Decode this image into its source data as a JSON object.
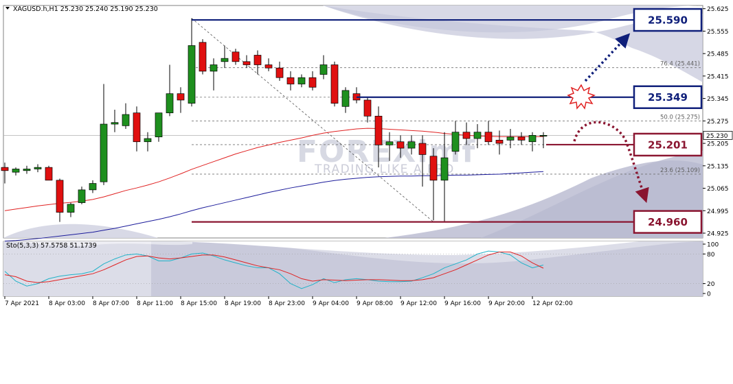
{
  "header": {
    "symbol_line": "XAGUSD.h,H1  25.230 25.240 25.190 25.230"
  },
  "watermark": {
    "brand": "FOREXimf",
    "tagline": "TRADING LIKE A PRO"
  },
  "colors": {
    "bull": "#1e8f1e",
    "bear": "#e01010",
    "navy": "#0f1f7a",
    "maroon": "#8a1530",
    "ma_fast": "#e02020",
    "ma_slow": "#1a1a9a",
    "stoch_main": "#20b2c8",
    "stoch_signal": "#e02020",
    "grid": "#c8c8c8",
    "swoosh": "#aeb0c8"
  },
  "chart_data": [
    {
      "type": "candlestick",
      "symbol": "XAGUSD.h",
      "timeframe": "H1",
      "ylim": [
        24.91,
        25.635
      ],
      "y_ticks": [
        "25.625",
        "25.555",
        "25.485",
        "25.415",
        "25.345",
        "25.275",
        "25.205",
        "25.135",
        "25.065",
        "24.995",
        "24.925"
      ],
      "current_price_label": "25.230",
      "x_labels": [
        "7 Apr 2021",
        "8 Apr 03:00",
        "8 Apr 07:00",
        "8 Apr 11:00",
        "8 Apr 15:00",
        "8 Apr 19:00",
        "8 Apr 23:00",
        "9 Apr 04:00",
        "9 Apr 08:00",
        "9 Apr 12:00",
        "9 Apr 16:00",
        "9 Apr 20:00",
        "12 Apr 02:00"
      ],
      "x_label_bars": [
        0,
        4,
        8,
        12,
        16,
        20,
        24,
        28,
        32,
        36,
        40,
        44,
        48
      ],
      "candles": [
        {
          "o": 25.13,
          "h": 25.145,
          "l": 25.08,
          "c": 25.12
        },
        {
          "o": 25.115,
          "h": 25.13,
          "l": 25.105,
          "c": 25.125
        },
        {
          "o": 25.12,
          "h": 25.135,
          "l": 25.11,
          "c": 25.125
        },
        {
          "o": 25.125,
          "h": 25.14,
          "l": 25.115,
          "c": 25.13
        },
        {
          "o": 25.13,
          "h": 25.135,
          "l": 25.1,
          "c": 25.09
        },
        {
          "o": 25.09,
          "h": 25.095,
          "l": 24.96,
          "c": 24.99
        },
        {
          "o": 24.99,
          "h": 25.02,
          "l": 24.975,
          "c": 25.015
        },
        {
          "o": 25.02,
          "h": 25.07,
          "l": 25.015,
          "c": 25.06
        },
        {
          "o": 25.06,
          "h": 25.09,
          "l": 25.05,
          "c": 25.08
        },
        {
          "o": 25.085,
          "h": 25.39,
          "l": 25.075,
          "c": 25.265
        },
        {
          "o": 25.265,
          "h": 25.31,
          "l": 25.24,
          "c": 25.27
        },
        {
          "o": 25.26,
          "h": 25.33,
          "l": 25.25,
          "c": 25.295
        },
        {
          "o": 25.3,
          "h": 25.32,
          "l": 25.18,
          "c": 25.21
        },
        {
          "o": 25.21,
          "h": 25.24,
          "l": 25.18,
          "c": 25.22
        },
        {
          "o": 25.225,
          "h": 25.3,
          "l": 25.21,
          "c": 25.3
        },
        {
          "o": 25.3,
          "h": 25.45,
          "l": 25.29,
          "c": 25.36
        },
        {
          "o": 25.36,
          "h": 25.38,
          "l": 25.3,
          "c": 25.34
        },
        {
          "o": 25.33,
          "h": 25.595,
          "l": 25.32,
          "c": 25.51
        },
        {
          "o": 25.52,
          "h": 25.53,
          "l": 25.42,
          "c": 25.43
        },
        {
          "o": 25.43,
          "h": 25.47,
          "l": 25.37,
          "c": 25.45
        },
        {
          "o": 25.46,
          "h": 25.51,
          "l": 25.44,
          "c": 25.47
        },
        {
          "o": 25.49,
          "h": 25.5,
          "l": 25.45,
          "c": 25.46
        },
        {
          "o": 25.46,
          "h": 25.48,
          "l": 25.44,
          "c": 25.45
        },
        {
          "o": 25.48,
          "h": 25.495,
          "l": 25.42,
          "c": 25.45
        },
        {
          "o": 25.45,
          "h": 25.47,
          "l": 25.43,
          "c": 25.44
        },
        {
          "o": 25.44,
          "h": 25.46,
          "l": 25.4,
          "c": 25.41
        },
        {
          "o": 25.41,
          "h": 25.43,
          "l": 25.37,
          "c": 25.39
        },
        {
          "o": 25.39,
          "h": 25.42,
          "l": 25.38,
          "c": 25.41
        },
        {
          "o": 25.41,
          "h": 25.43,
          "l": 25.37,
          "c": 25.38
        },
        {
          "o": 25.42,
          "h": 25.48,
          "l": 25.405,
          "c": 25.45
        },
        {
          "o": 25.45,
          "h": 25.46,
          "l": 25.32,
          "c": 25.33
        },
        {
          "o": 25.32,
          "h": 25.38,
          "l": 25.3,
          "c": 25.37
        },
        {
          "o": 25.36,
          "h": 25.38,
          "l": 25.33,
          "c": 25.34
        },
        {
          "o": 25.34,
          "h": 25.35,
          "l": 25.27,
          "c": 25.29
        },
        {
          "o": 25.29,
          "h": 25.32,
          "l": 25.13,
          "c": 25.2
        },
        {
          "o": 25.2,
          "h": 25.24,
          "l": 25.15,
          "c": 25.21
        },
        {
          "o": 25.21,
          "h": 25.23,
          "l": 25.16,
          "c": 25.19
        },
        {
          "o": 25.19,
          "h": 25.23,
          "l": 25.17,
          "c": 25.21
        },
        {
          "o": 25.205,
          "h": 25.23,
          "l": 25.07,
          "c": 25.17
        },
        {
          "o": 25.165,
          "h": 25.19,
          "l": 24.965,
          "c": 25.09
        },
        {
          "o": 25.09,
          "h": 25.24,
          "l": 24.96,
          "c": 25.16
        },
        {
          "o": 25.18,
          "h": 25.275,
          "l": 25.17,
          "c": 25.24
        },
        {
          "o": 25.24,
          "h": 25.27,
          "l": 25.2,
          "c": 25.22
        },
        {
          "o": 25.22,
          "h": 25.265,
          "l": 25.19,
          "c": 25.24
        },
        {
          "o": 25.24,
          "h": 25.275,
          "l": 25.2,
          "c": 25.21
        },
        {
          "o": 25.215,
          "h": 25.245,
          "l": 25.17,
          "c": 25.205
        },
        {
          "o": 25.215,
          "h": 25.25,
          "l": 25.19,
          "c": 25.225
        },
        {
          "o": 25.225,
          "h": 25.24,
          "l": 25.2,
          "c": 25.215
        },
        {
          "o": 25.21,
          "h": 25.24,
          "l": 25.18,
          "c": 25.23
        },
        {
          "o": 25.23,
          "h": 25.24,
          "l": 25.19,
          "c": 25.23
        }
      ],
      "ma_fast": [
        24.995,
        25.0,
        25.005,
        25.01,
        25.014,
        25.018,
        25.021,
        25.025,
        25.03,
        25.038,
        25.048,
        25.058,
        25.066,
        25.075,
        25.085,
        25.097,
        25.11,
        25.124,
        25.136,
        25.148,
        25.16,
        25.172,
        25.182,
        25.192,
        25.2,
        25.208,
        25.215,
        25.222,
        25.23,
        25.237,
        25.242,
        25.246,
        25.25,
        25.252,
        25.251,
        25.249,
        25.247,
        25.245,
        25.243,
        25.24,
        25.236,
        25.233,
        25.23,
        25.228,
        25.227,
        25.226,
        25.226,
        25.226,
        25.226,
        25.226
      ],
      "ma_slow": [
        24.9,
        24.902,
        24.905,
        24.908,
        24.912,
        24.916,
        24.92,
        24.924,
        24.928,
        24.934,
        24.94,
        24.947,
        24.954,
        24.961,
        24.968,
        24.976,
        24.985,
        24.995,
        25.004,
        25.012,
        25.02,
        25.028,
        25.036,
        25.044,
        25.052,
        25.059,
        25.066,
        25.072,
        25.078,
        25.084,
        25.089,
        25.093,
        25.096,
        25.099,
        25.101,
        25.102,
        25.103,
        25.103,
        25.104,
        25.104,
        25.105,
        25.106,
        25.106,
        25.107,
        25.108,
        25.109,
        25.111,
        25.113,
        25.115,
        25.117
      ],
      "fib_levels": [
        {
          "label": "76.4 (25.441)",
          "value": 25.441
        },
        {
          "label": "50.0 (25.275)",
          "value": 25.275
        },
        {
          "label": "23.6 (25.109)",
          "value": 25.109
        }
      ],
      "fib_range": {
        "high": 25.595,
        "low": 24.96,
        "bar_start": 17,
        "bar_end": 39
      },
      "extra_dashed_levels": [
        25.349,
        25.201
      ],
      "key_levels": [
        {
          "label": "25.590",
          "value": 25.59,
          "color": "navy",
          "bar_start": 17
        },
        {
          "label": "25.349",
          "value": 25.349,
          "color": "navy",
          "bar_start": 32
        },
        {
          "label": "25.201",
          "value": 25.201,
          "color": "maroon",
          "bar_start": 49
        },
        {
          "label": "24.960",
          "value": 24.96,
          "color": "maroon",
          "bar_start": 17
        }
      ]
    },
    {
      "type": "line",
      "title": "Sto(5,3,3) 57.5758 51.1739",
      "ylim": [
        0,
        100
      ],
      "y_ticks": [
        "100",
        "80",
        "20",
        "0"
      ],
      "series": [
        {
          "key": "main",
          "values": [
            45,
            25,
            15,
            20,
            30,
            35,
            38,
            40,
            45,
            60,
            70,
            78,
            80,
            76,
            66,
            66,
            72,
            80,
            82,
            76,
            68,
            62,
            56,
            52,
            52,
            40,
            20,
            10,
            18,
            30,
            22,
            28,
            30,
            28,
            25,
            24,
            24,
            25,
            32,
            40,
            52,
            60,
            68,
            80,
            86,
            84,
            78,
            62,
            52,
            57.6
          ]
        },
        {
          "key": "signal",
          "values": [
            38,
            34,
            25,
            22,
            24,
            28,
            32,
            36,
            40,
            48,
            58,
            68,
            75,
            76,
            72,
            70,
            72,
            75,
            78,
            78,
            74,
            68,
            62,
            56,
            52,
            48,
            40,
            30,
            25,
            28,
            27,
            26,
            27,
            28,
            28,
            27,
            26,
            26,
            28,
            32,
            40,
            48,
            58,
            68,
            78,
            84,
            84,
            76,
            62,
            51.2
          ]
        }
      ]
    }
  ]
}
